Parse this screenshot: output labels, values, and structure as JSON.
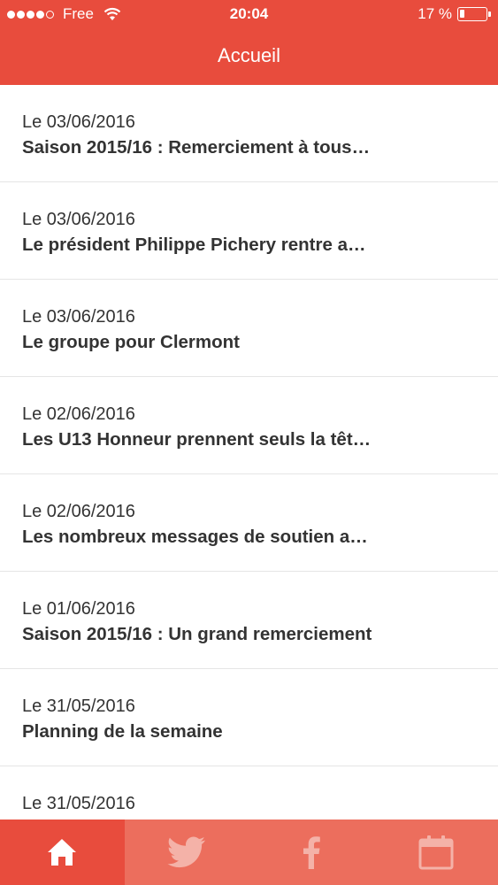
{
  "status_bar": {
    "carrier": "Free",
    "time": "20:04",
    "battery": "17 %",
    "battery_level": 0.17
  },
  "nav": {
    "title": "Accueil"
  },
  "articles": [
    {
      "date": "Le 03/06/2016",
      "title": "Saison 2015/16 : Remerciement à tous…"
    },
    {
      "date": "Le 03/06/2016",
      "title": "Le président Philippe Pichery rentre a…"
    },
    {
      "date": "Le 03/06/2016",
      "title": "Le groupe pour Clermont"
    },
    {
      "date": "Le 02/06/2016",
      "title": "Les U13 Honneur prennent seuls la têt…"
    },
    {
      "date": "Le 02/06/2016",
      "title": "Les nombreux messages de soutien a…"
    },
    {
      "date": "Le 01/06/2016",
      "title": "Saison 2015/16 : Un grand remerciement"
    },
    {
      "date": "Le 31/05/2016",
      "title": "Planning de la semaine"
    },
    {
      "date": "Le 31/05/2016",
      "title": ""
    }
  ],
  "tabs": [
    {
      "icon": "home-icon",
      "active": true
    },
    {
      "icon": "twitter-icon",
      "active": false
    },
    {
      "icon": "facebook-icon",
      "active": false
    },
    {
      "icon": "calendar-icon",
      "active": false
    }
  ],
  "colors": {
    "accent": "#e84c3d",
    "tab_inactive": "#ec6e5d",
    "icon_inactive": "#f4b2a8"
  }
}
